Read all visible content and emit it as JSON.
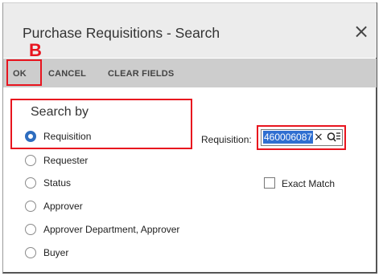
{
  "dialog": {
    "title": "Purchase Requisitions - Search",
    "close_glyph": "×",
    "annotation_marker": "B"
  },
  "toolbar": {
    "ok_label": "OK",
    "cancel_label": "CANCEL",
    "clear_fields_label": "CLEAR FIELDS"
  },
  "search_by": {
    "label": "Search by",
    "options": [
      {
        "label": "Requisition",
        "selected": true
      },
      {
        "label": "Requester",
        "selected": false
      },
      {
        "label": "Status",
        "selected": false
      },
      {
        "label": "Approver",
        "selected": false
      },
      {
        "label": "Approver Department, Approver",
        "selected": false
      },
      {
        "label": "Buyer",
        "selected": false
      }
    ]
  },
  "requisition_field": {
    "label": "Requisition:",
    "value": "460006087",
    "clear_glyph": "×"
  },
  "exact_match": {
    "label": "Exact Match",
    "checked": false
  },
  "colors": {
    "highlight": "#e8141e",
    "selected_radio": "#2e6dbf",
    "selection_bg": "#2f6fd1",
    "toolbar_bg": "#cdcdcd",
    "header_bg": "#ececec"
  },
  "icons": {
    "close": "close-icon",
    "clear": "clear-icon",
    "lookup": "lookup-search-icon"
  }
}
